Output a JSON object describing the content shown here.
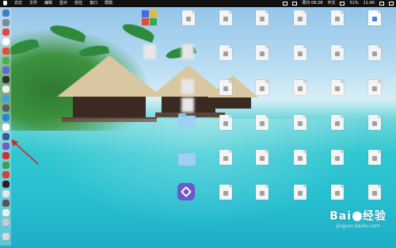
{
  "menubar": {
    "items": [
      "访达",
      "文件",
      "编辑",
      "显示",
      "前往",
      "窗口",
      "帮助"
    ],
    "datetime": "周日 08:28",
    "input_method": "中文",
    "battery": "51%",
    "extra": "11:40"
  },
  "watermark": {
    "brand_left": "Bai",
    "brand_right": "经验",
    "url": "jingyan.baidu.com"
  },
  "colors": {
    "menubar_bg": "#111111",
    "arrow": "#d62828",
    "app_purple": "#6b59c8"
  },
  "icons": [
    "apple-icon",
    "document-icon",
    "folder-icon",
    "app-icon",
    "finder-icon",
    "trash-icon"
  ]
}
